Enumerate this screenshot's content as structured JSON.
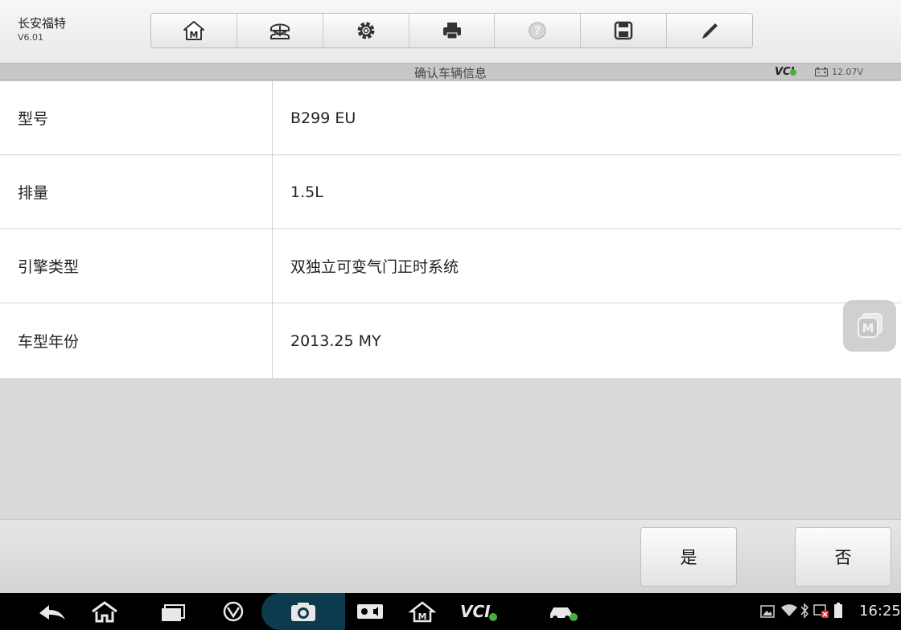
{
  "header": {
    "app_title": "长安福特",
    "version": "V6.01",
    "toolbar": [
      "home-icon",
      "vehicle-swap-icon",
      "settings-icon",
      "print-icon",
      "help-icon",
      "save-icon",
      "edit-icon"
    ]
  },
  "titlebar": {
    "title": "确认车辆信息",
    "vci_label": "VCI",
    "voltage": "12.07V"
  },
  "vehicle_info": [
    {
      "label": "型号",
      "value": "B299 EU"
    },
    {
      "label": "排量",
      "value": "1.5L"
    },
    {
      "label": "引擎类型",
      "value": "双独立可变气门正时系统"
    },
    {
      "label": "车型年份",
      "value": "2013.25 MY"
    }
  ],
  "floating_button": {
    "icon": "m-icon",
    "label": "M"
  },
  "actions": {
    "yes": "是",
    "no": "否"
  },
  "system_bar": {
    "clock": "16:25",
    "vci_label": "VCI",
    "home_letter": "M",
    "accent": "#47b03c"
  }
}
